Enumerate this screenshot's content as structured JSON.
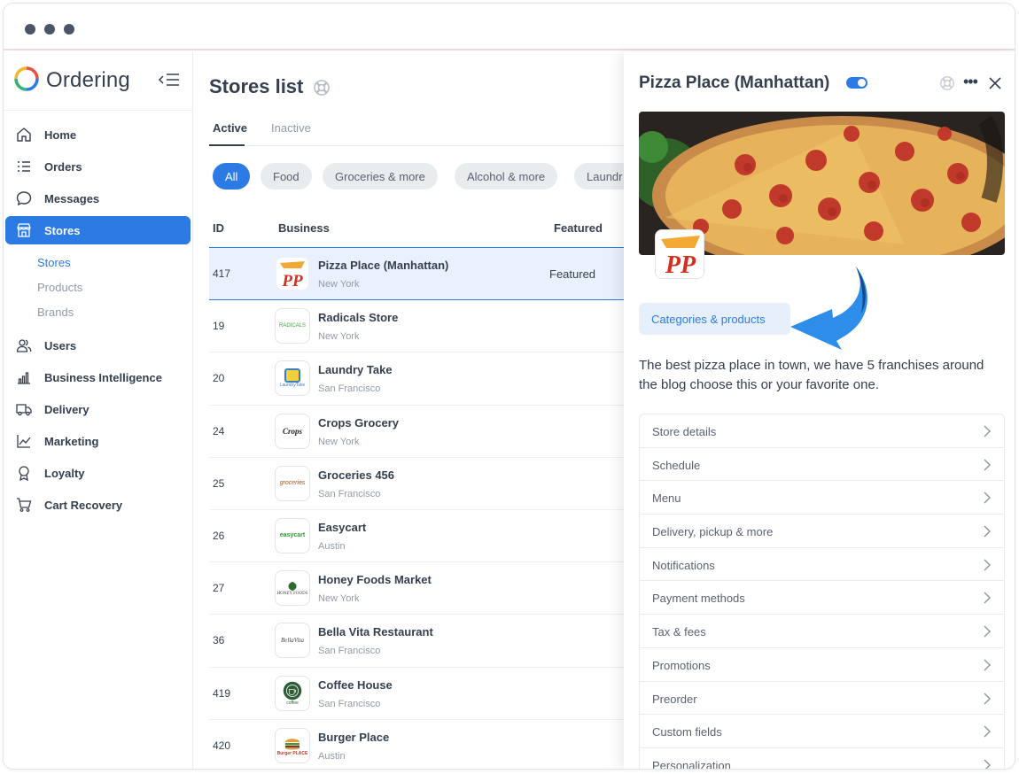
{
  "app": {
    "name": "Ordering"
  },
  "colors": {
    "accent": "#2c7be5",
    "text": "#344050",
    "muted": "#909ba9",
    "chip_bg": "#e9ecef"
  },
  "sidebar": {
    "items": [
      {
        "label": "Home",
        "icon": "home-icon"
      },
      {
        "label": "Orders",
        "icon": "list-icon"
      },
      {
        "label": "Messages",
        "icon": "chat-icon"
      },
      {
        "label": "Stores",
        "icon": "shop-icon",
        "active": true
      },
      {
        "label": "Users",
        "icon": "users-icon"
      },
      {
        "label": "Business Intelligence",
        "icon": "bar-chart-icon"
      },
      {
        "label": "Delivery",
        "icon": "truck-icon"
      },
      {
        "label": "Marketing",
        "icon": "graph-icon"
      },
      {
        "label": "Loyalty",
        "icon": "award-icon"
      },
      {
        "label": "Cart Recovery",
        "icon": "cart-icon"
      }
    ],
    "stores_sub": [
      {
        "label": "Stores",
        "active": true
      },
      {
        "label": "Products"
      },
      {
        "label": "Brands"
      }
    ]
  },
  "main": {
    "title": "Stores list",
    "tabs": [
      {
        "label": "Active"
      },
      {
        "label": "Inactive"
      }
    ],
    "chips": [
      "All",
      "Food",
      "Groceries & more",
      "Alcohol & more",
      "Laundr"
    ],
    "columns": {
      "id": "ID",
      "business": "Business",
      "featured": "Featured"
    },
    "rows": [
      {
        "id": "417",
        "name": "Pizza Place (Manhattan)",
        "city": "New York",
        "featured": "Featured",
        "logo": "PP"
      },
      {
        "id": "19",
        "name": "Radicals Store",
        "city": "New York",
        "featured": "",
        "logo": "RADICALS"
      },
      {
        "id": "20",
        "name": "Laundry Take",
        "city": "San Francisco",
        "featured": "",
        "logo": "LaundryTake"
      },
      {
        "id": "24",
        "name": "Crops Grocery",
        "city": "New York",
        "featured": "",
        "logo": "Crops"
      },
      {
        "id": "25",
        "name": "Groceries 456",
        "city": "San Francisco",
        "featured": "",
        "logo": "groceries"
      },
      {
        "id": "26",
        "name": "Easycart",
        "city": "Austin",
        "featured": "",
        "logo": "easycart"
      },
      {
        "id": "27",
        "name": "Honey Foods Market",
        "city": "New York",
        "featured": "",
        "logo": "HONEY FOODS"
      },
      {
        "id": "36",
        "name": "Bella Vita Restaurant",
        "city": "San Francisco",
        "featured": "",
        "logo": "BellaVita"
      },
      {
        "id": "419",
        "name": "Coffee House",
        "city": "San Francisco",
        "featured": "",
        "logo": "coffee"
      },
      {
        "id": "420",
        "name": "Burger Place",
        "city": "Austin",
        "featured": "",
        "logo": "Burger PLACE"
      }
    ]
  },
  "panel": {
    "title": "Pizza Place (Manhattan)",
    "category_button": "Categories & products",
    "description": "The best pizza place in town, we have 5 franchises around the blog choose this or your favorite one.",
    "logo_text": "PP",
    "menu": [
      "Store details",
      "Schedule",
      "Menu",
      "Delivery, pickup & more",
      "Notifications",
      "Payment methods",
      "Tax & fees",
      "Promotions",
      "Preorder",
      "Custom fields",
      "Personalization"
    ]
  }
}
